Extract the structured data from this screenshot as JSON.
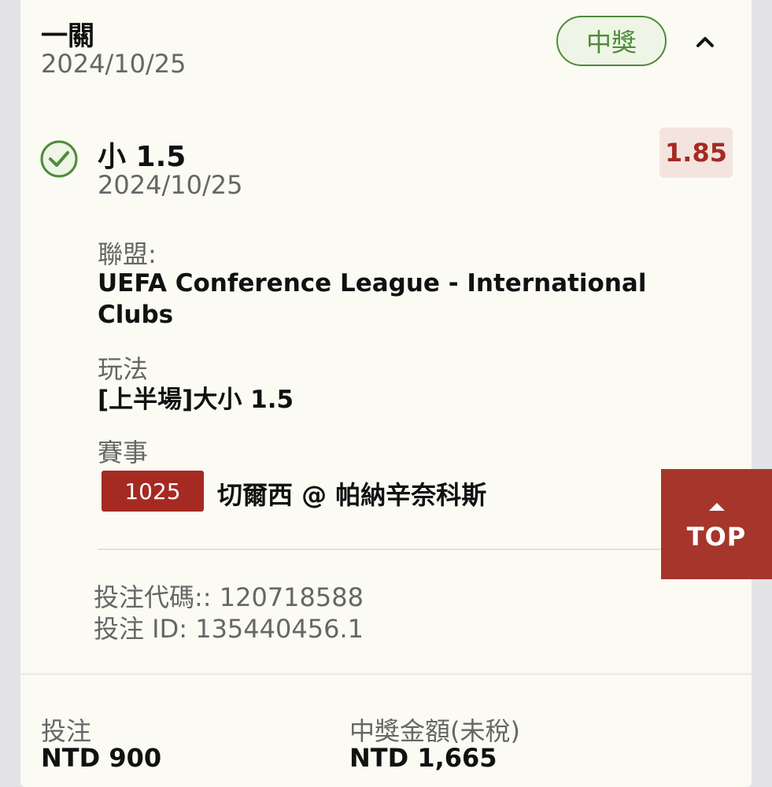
{
  "bet": {
    "type": "一關",
    "date": "2024/10/25",
    "status": "中獎"
  },
  "selection": {
    "name": "小 1.5",
    "date": "2024/10/25",
    "odds": "1.85",
    "league_label": "聯盟:",
    "league_value_line1": "UEFA Conference League - International",
    "league_value_line2": "Clubs",
    "market_label": "玩法",
    "market_value": "[上半場]大小 1.5",
    "event_label": "賽事",
    "event_number": "1025",
    "event_name": "切爾西 @ 帕納辛奈科斯"
  },
  "codes": {
    "bet_code": "投注代碼:: 120718588",
    "bet_id": "投注 ID: 135440456.1"
  },
  "footer": {
    "stake_label": "投注",
    "stake_value": "NTD 900",
    "payout_label": "中獎金額(未稅)",
    "payout_value": "NTD 1,665"
  },
  "top_button": {
    "label": "TOP"
  },
  "colors": {
    "accent_red": "#a52a22",
    "win_green": "#4e8a3a",
    "card_bg": "#fbfbf3"
  },
  "icons": {
    "check": "check-circle-icon",
    "collapse": "chevron-up-icon",
    "top_arrow": "arrow-up-icon"
  }
}
